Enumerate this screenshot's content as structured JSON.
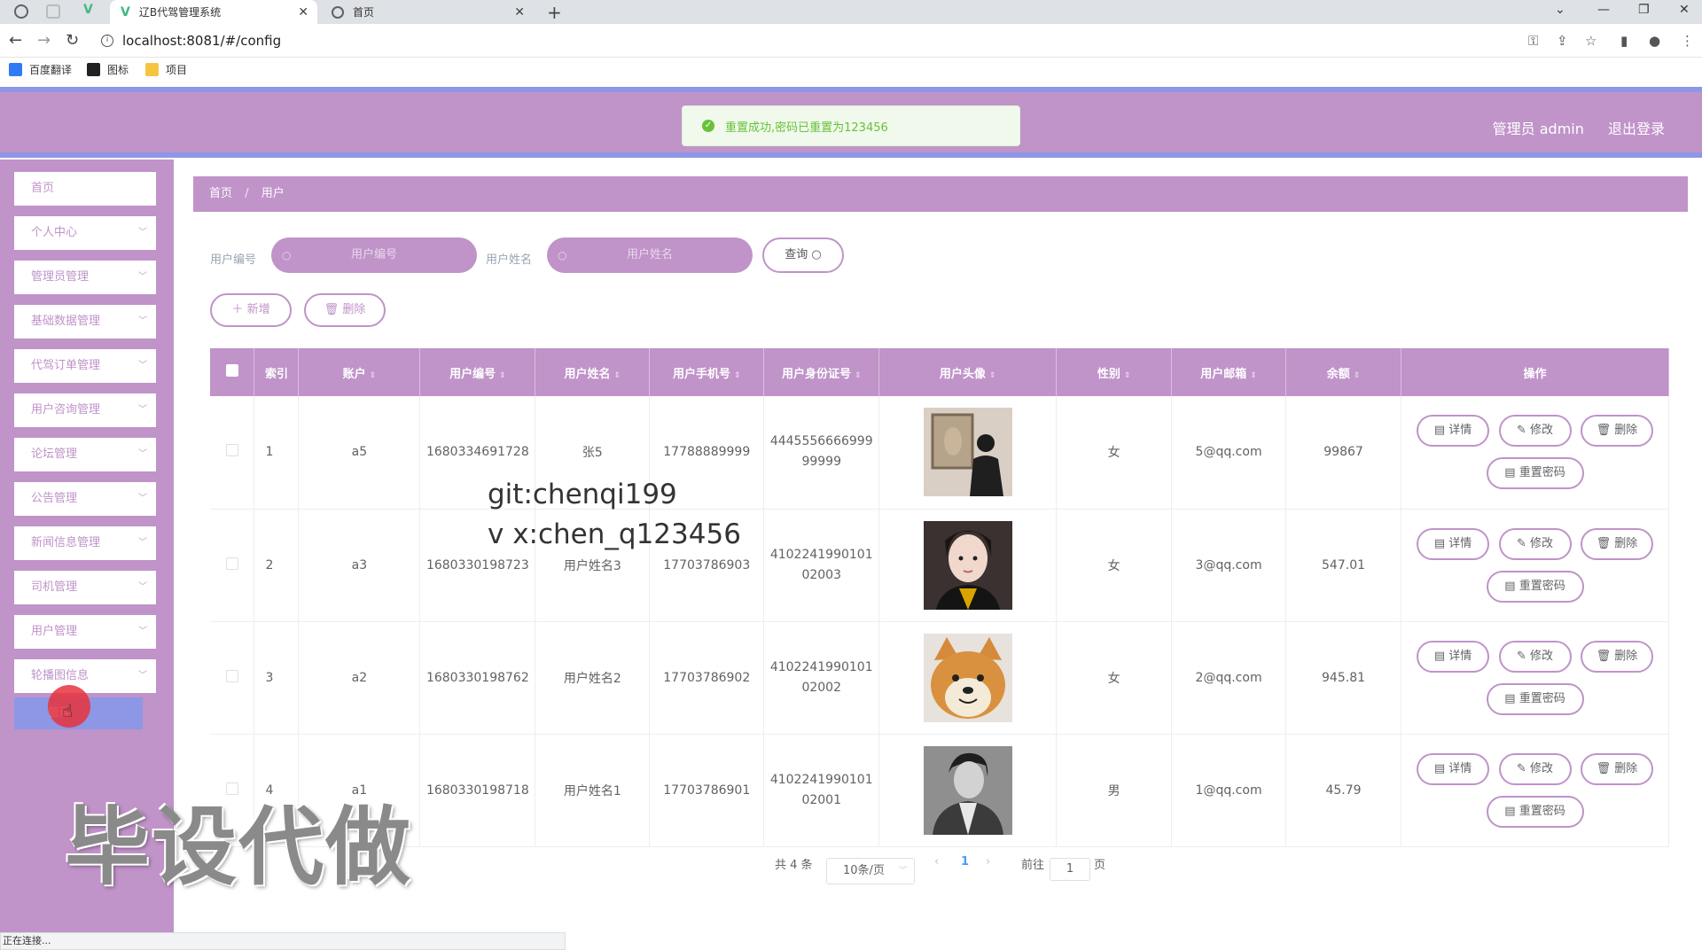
{
  "browser": {
    "tabs": [
      {
        "title": "辽B代驾管理系统"
      },
      {
        "title": "首页"
      }
    ],
    "url": "localhost:8081/#/config",
    "bookmarks": [
      {
        "label": "百度翻译",
        "color": "#2f7bf5"
      },
      {
        "label": "图标",
        "color": "#222222"
      },
      {
        "label": "项目",
        "color": "#f5c542"
      }
    ],
    "status": "正在连接..."
  },
  "header": {
    "user": "管理员 admin",
    "logout": "退出登录",
    "toast": "重置成功,密码已重置为123456"
  },
  "sidebar": {
    "items": [
      {
        "label": "首页",
        "chevron": false
      },
      {
        "label": "个人中心",
        "chevron": true
      },
      {
        "label": "管理员管理",
        "chevron": true
      },
      {
        "label": "基础数据管理",
        "chevron": true
      },
      {
        "label": "代驾订单管理",
        "chevron": true
      },
      {
        "label": "用户咨询管理",
        "chevron": true
      },
      {
        "label": "论坛管理",
        "chevron": true
      },
      {
        "label": "公告管理",
        "chevron": true
      },
      {
        "label": "新闻信息管理",
        "chevron": true
      },
      {
        "label": "司机管理",
        "chevron": true
      },
      {
        "label": "用户管理",
        "chevron": true
      },
      {
        "label": "轮播图信息",
        "chevron": true
      }
    ],
    "sub_item": "管理"
  },
  "breadcrumb": {
    "home": "首页",
    "current": "用户"
  },
  "filters": {
    "user_no_label": "用户编号",
    "user_no_placeholder": "用户编号",
    "user_name_label": "用户姓名",
    "user_name_placeholder": "用户姓名",
    "query": "查询"
  },
  "ops": {
    "add": "新增",
    "delete": "删除"
  },
  "table": {
    "columns": [
      "索引",
      "账户",
      "用户编号",
      "用户姓名",
      "用户手机号",
      "用户身份证号",
      "用户头像",
      "性别",
      "用户邮箱",
      "余额",
      "操作"
    ],
    "rows": [
      {
        "index": "1",
        "account": "a5",
        "user_no": "1680334691728",
        "name": "张5",
        "phone": "17788889999",
        "id_1": "4445556666999",
        "id_2": "99999",
        "gender": "女",
        "email": "5@qq.com",
        "balance": "99867",
        "avatar": "person-back-gallery"
      },
      {
        "index": "2",
        "account": "a3",
        "user_no": "1680330198723",
        "name": "用户姓名3",
        "phone": "17703786903",
        "id_1": "4102241990101",
        "id_2": "02003",
        "gender": "女",
        "email": "3@qq.com",
        "balance": "547.01",
        "avatar": "woman-portrait"
      },
      {
        "index": "3",
        "account": "a2",
        "user_no": "1680330198762",
        "name": "用户姓名2",
        "phone": "17703786902",
        "id_1": "4102241990101",
        "id_2": "02002",
        "gender": "女",
        "email": "2@qq.com",
        "balance": "945.81",
        "avatar": "shiba-dog"
      },
      {
        "index": "4",
        "account": "a1",
        "user_no": "1680330198718",
        "name": "用户姓名1",
        "phone": "17703786901",
        "id_1": "4102241990101",
        "id_2": "02001",
        "gender": "男",
        "email": "1@qq.com",
        "balance": "45.79",
        "avatar": "man-bw-portrait"
      }
    ],
    "actions": {
      "detail": "详情",
      "edit": "修改",
      "delete": "删除",
      "reset": "重置密码"
    }
  },
  "pagination": {
    "total": "共 4 条",
    "size": "10条/页",
    "page": "1",
    "goto": "前往",
    "goto_value": "1",
    "page_unit": "页"
  },
  "overlays": {
    "line1": "git:chenqi199",
    "line2": "v x:chen_q123456",
    "watermark": "毕设代做"
  },
  "colors": {
    "theme": "#c093c9",
    "accent": "#8d97e6",
    "success": "#67c23a"
  }
}
